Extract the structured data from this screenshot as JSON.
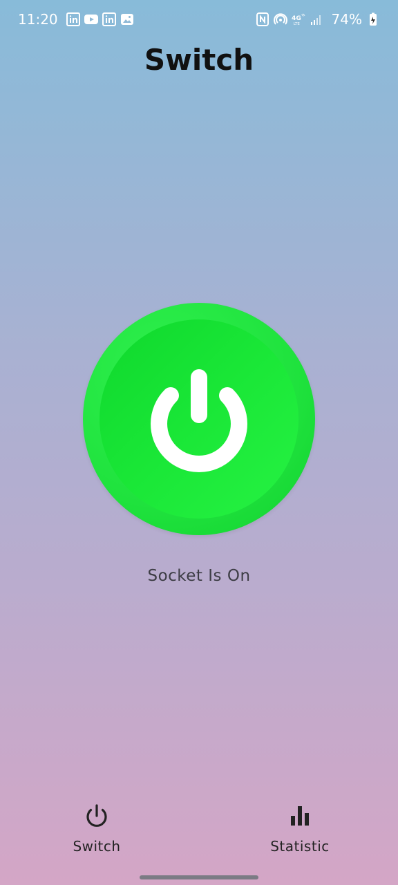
{
  "status_bar": {
    "time": "11:20",
    "battery": "74%",
    "left_icons": [
      "linkedin-icon",
      "youtube-icon",
      "linkedin-icon",
      "gallery-icon"
    ],
    "right_icons": [
      "nfc-icon",
      "hotspot-icon",
      "4g-lte-icon",
      "signal-icon",
      "battery-icon"
    ]
  },
  "page": {
    "title": "Switch"
  },
  "power": {
    "status_text": "Socket Is On",
    "button_color": "#1fe23d"
  },
  "bottom_nav": {
    "items": [
      {
        "label": "Switch",
        "icon": "power-icon"
      },
      {
        "label": "Statistic",
        "icon": "bar-chart-icon"
      }
    ]
  }
}
